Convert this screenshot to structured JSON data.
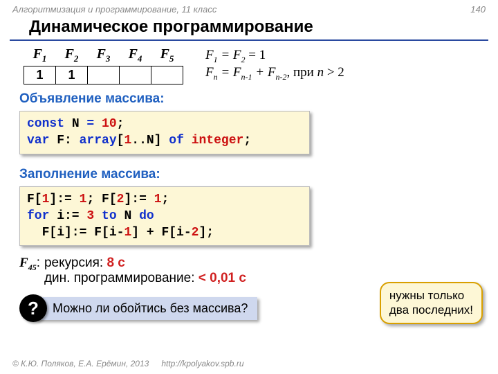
{
  "meta": {
    "course": "Алгоритмизация и программирование, 11 класс",
    "page": "140",
    "copyright": "© К.Ю. Поляков, Е.А. Ерёмин, 2013",
    "url": "http://kpolyakov.spb.ru"
  },
  "title": "Динамическое программирование",
  "table": {
    "headers": [
      "F",
      "F",
      "F",
      "F",
      "F"
    ],
    "subs": [
      "1",
      "2",
      "3",
      "4",
      "5"
    ],
    "cells": [
      "1",
      "1",
      "",
      "",
      ""
    ]
  },
  "formulas": {
    "line1a": "F",
    "line1as": "1",
    "line1b": " = F",
    "line1bs": "2",
    "line1c": " = 1",
    "line2a": "F",
    "line2as": "n",
    "line2b": " = F",
    "line2bs": "n-1",
    "line2c": " + F",
    "line2cs": "n-2",
    "line2d": ", при ",
    "line2e": "n",
    "line2f": " > 2"
  },
  "sections": {
    "decl": "Объявление массива:",
    "fill": "Заполнение массива:"
  },
  "code1": {
    "t1": "const",
    "t2": " N ",
    "t3": "=",
    "t4": " 10",
    "t5": ";",
    "t6": "var",
    "t7": " F: ",
    "t8": "array",
    "t9": "[",
    "t10": "1",
    "t11": "..N] ",
    "t12": "of",
    "t13": " ",
    "t14": "integer",
    "t15": ";"
  },
  "code2": {
    "a1": "F[",
    "a2": "1",
    "a3": "]:= ",
    "a4": "1",
    "a5": "; F[",
    "a6": "2",
    "a7": "]:= ",
    "a8": "1",
    "a9": ";",
    "b1": "for",
    "b2": " i:= ",
    "b3": "3",
    "b4": " ",
    "b5": "to",
    "b6": " N ",
    "b7": "do",
    "c1": "  F[i]:= F[i-",
    "c2": "1",
    "c3": "] + F[i-",
    "c4": "2",
    "c5": "];"
  },
  "timing": {
    "label": "F",
    "labelsub": "45",
    "colon": ":",
    "r1a": "рекурсия: ",
    "r1b": "8 с",
    "r2a": "дин. программирование: ",
    "r2b": "< 0,01 с"
  },
  "callout": {
    "line1": "нужны только",
    "line2": "два последних!"
  },
  "question": {
    "mark": "?",
    "text": "Можно ли обойтись без массива?"
  }
}
